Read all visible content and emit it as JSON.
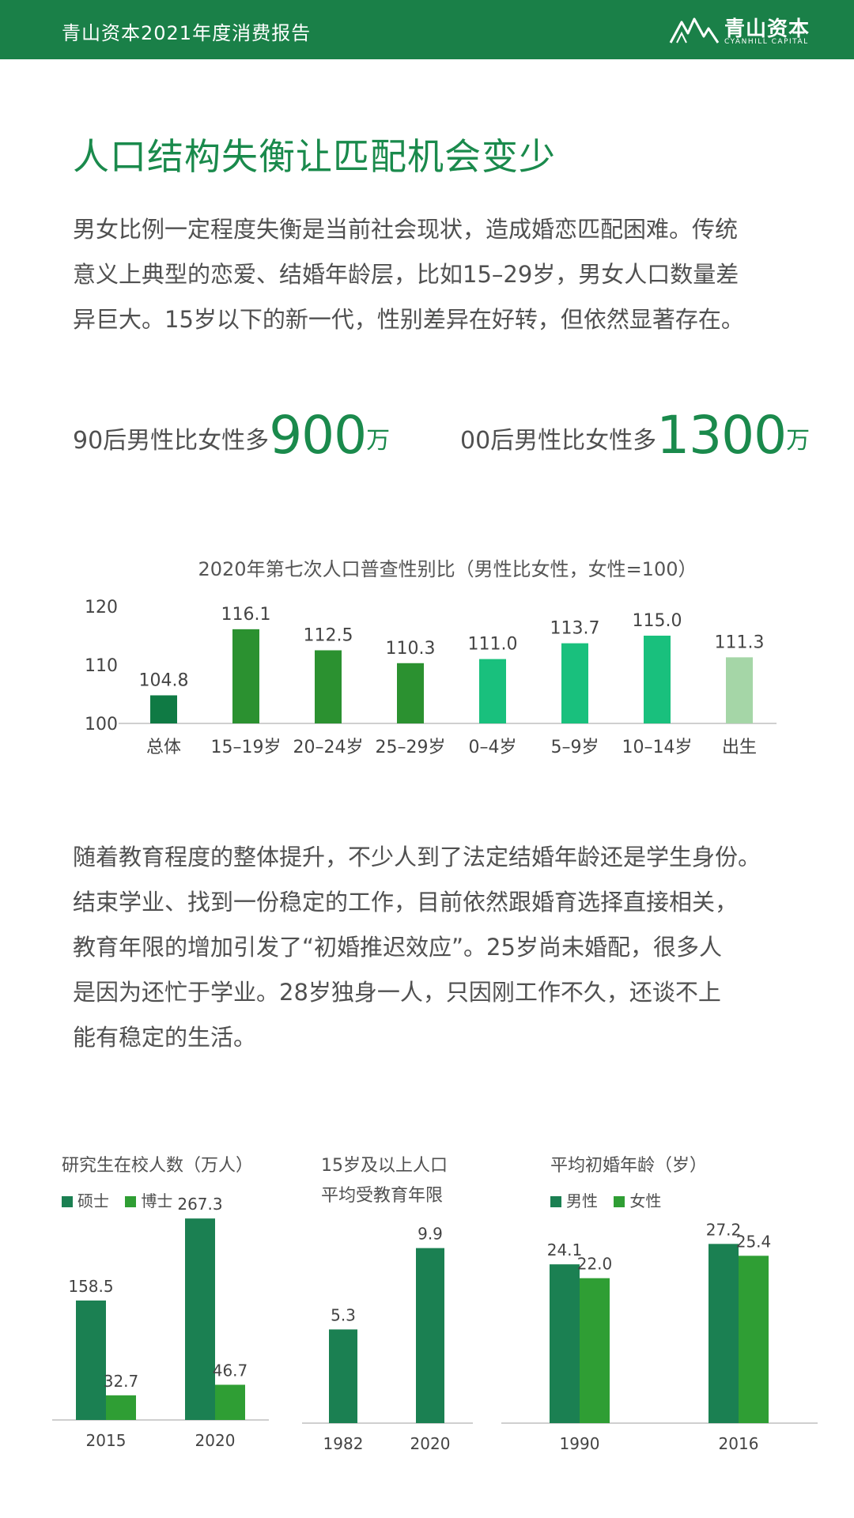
{
  "header": {
    "title": "青山资本2021年度消费报告",
    "logo_cn": "青山资本",
    "logo_en": "CYANHILL CAPITAL"
  },
  "headline": "人口结构失衡让匹配机会变少",
  "paragraph1": [
    "男女比例一定程度失衡是当前社会现状，造成婚恋匹配困难。传统",
    "意义上典型的恋爱、结婚年龄层，比如15–29岁，男女人口数量差",
    "异巨大。15岁以下的新一代，性别差异在好转，但依然显著存在。"
  ],
  "stats": [
    {
      "prefix": "90后男性比女性多",
      "number": "900",
      "unit": "万"
    },
    {
      "prefix": "00后男性比女性多",
      "number": "1300",
      "unit": "万"
    }
  ],
  "paragraph2": [
    "随着教育程度的整体提升，不少人到了法定结婚年龄还是学生身份。",
    "结束学业、找到一份稳定的工作，目前依然跟婚育选择直接相关，",
    "教育年限的增加引发了“初婚推迟效应”。25岁尚未婚配，很多人",
    "是因为还忙于学业。28岁独身一人，只因刚工作不久，还谈不上",
    "能有稳定的生活。"
  ],
  "colors": {
    "brand": "#1a8048",
    "headline": "#1a8a4c",
    "dark_green": "#1b8052",
    "mid_green": "#2f9e34",
    "bright_green": "#19c07d",
    "pale_green": "#a5d6a7",
    "axis": "#cfcfcf"
  },
  "chart_data": [
    {
      "type": "bar",
      "title": "2020年第七次人口普查性别比（男性比女性，女性=100）",
      "categories": [
        "总体",
        "15–19岁",
        "20–24岁",
        "25–29岁",
        "0–4岁",
        "5–9岁",
        "10–14岁",
        "出生"
      ],
      "values": [
        104.8,
        116.1,
        112.5,
        110.3,
        111.0,
        113.7,
        115.0,
        111.3
      ],
      "value_labels": [
        "104.8",
        "116.1",
        "112.5",
        "110.3",
        "111.0",
        "113.7",
        "115.0",
        "111.3"
      ],
      "bar_colors": [
        "#0f7a44",
        "#2b9130",
        "#2b9130",
        "#2b9130",
        "#19c07d",
        "#19c07d",
        "#19c07d",
        "#a5d6a7"
      ],
      "ylim": [
        100,
        120
      ],
      "yticks": [
        "100",
        "110",
        "120"
      ],
      "grid": false
    },
    {
      "type": "bar",
      "title": "研究生在校人数（万人）",
      "categories": [
        "2015",
        "2020"
      ],
      "series": [
        {
          "name": "硕士",
          "values": [
            158.5,
            267.3
          ],
          "labels": [
            "158.5",
            "267.3"
          ],
          "color": "#1b8052"
        },
        {
          "name": "博士",
          "values": [
            32.7,
            46.7
          ],
          "labels": [
            "32.7",
            "46.7"
          ],
          "color": "#2f9e34"
        }
      ],
      "ylim": [
        0,
        300
      ],
      "legend": "top-left"
    },
    {
      "type": "bar",
      "title": "15岁及以上人口平均受教育年限",
      "title_lines": [
        "15岁及以上人口",
        "平均受教育年限"
      ],
      "categories": [
        "1982",
        "2020"
      ],
      "values": [
        5.3,
        9.9
      ],
      "value_labels": [
        "5.3",
        "9.9"
      ],
      "color": "#1b8052",
      "ylim": [
        0,
        11
      ]
    },
    {
      "type": "bar",
      "title": "平均初婚年龄（岁）",
      "categories": [
        "1990",
        "2016"
      ],
      "series": [
        {
          "name": "男性",
          "values": [
            24.1,
            27.2
          ],
          "labels": [
            "24.1",
            "27.2"
          ],
          "color": "#1b8052"
        },
        {
          "name": "女性",
          "values": [
            22.0,
            25.4
          ],
          "labels": [
            "22.0",
            "25.4"
          ],
          "color": "#2f9e34"
        }
      ],
      "ylim": [
        0,
        30
      ],
      "legend": "top-left"
    }
  ]
}
